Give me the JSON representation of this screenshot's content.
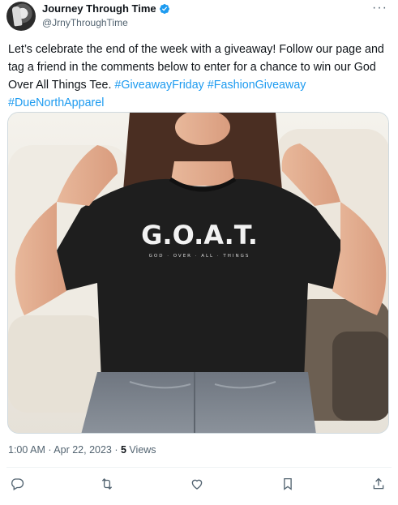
{
  "author": {
    "display_name": "Journey Through Time",
    "handle": "@JrnyThroughTime",
    "verified_icon": "verified-badge-icon",
    "more_icon": "more-options-icon"
  },
  "tweet": {
    "text_plain": "Let’s celebrate the end of the week with a giveaway! Follow our page and tag a friend in the comments below to enter for a chance to win our God Over All Things Tee. ",
    "hashtags": [
      "#GiveawayFriday",
      "#FashionGiveaway",
      "#DueNorthApparel"
    ],
    "media": {
      "shirt_title": "G.O.A.T.",
      "shirt_subtitle": "GOD · OVER · ALL · THINGS"
    }
  },
  "meta": {
    "time": "1:00 AM",
    "separator1": " · ",
    "date": "Apr 22, 2023",
    "separator2": " · ",
    "views_count": "5",
    "views_label": " Views"
  },
  "actions": [
    "reply-icon",
    "retweet-icon",
    "like-icon",
    "bookmark-icon",
    "share-icon"
  ],
  "colors": {
    "accent": "#1d9bf0",
    "text": "#0f1419",
    "muted": "#536471",
    "divider": "#eff3f4"
  }
}
